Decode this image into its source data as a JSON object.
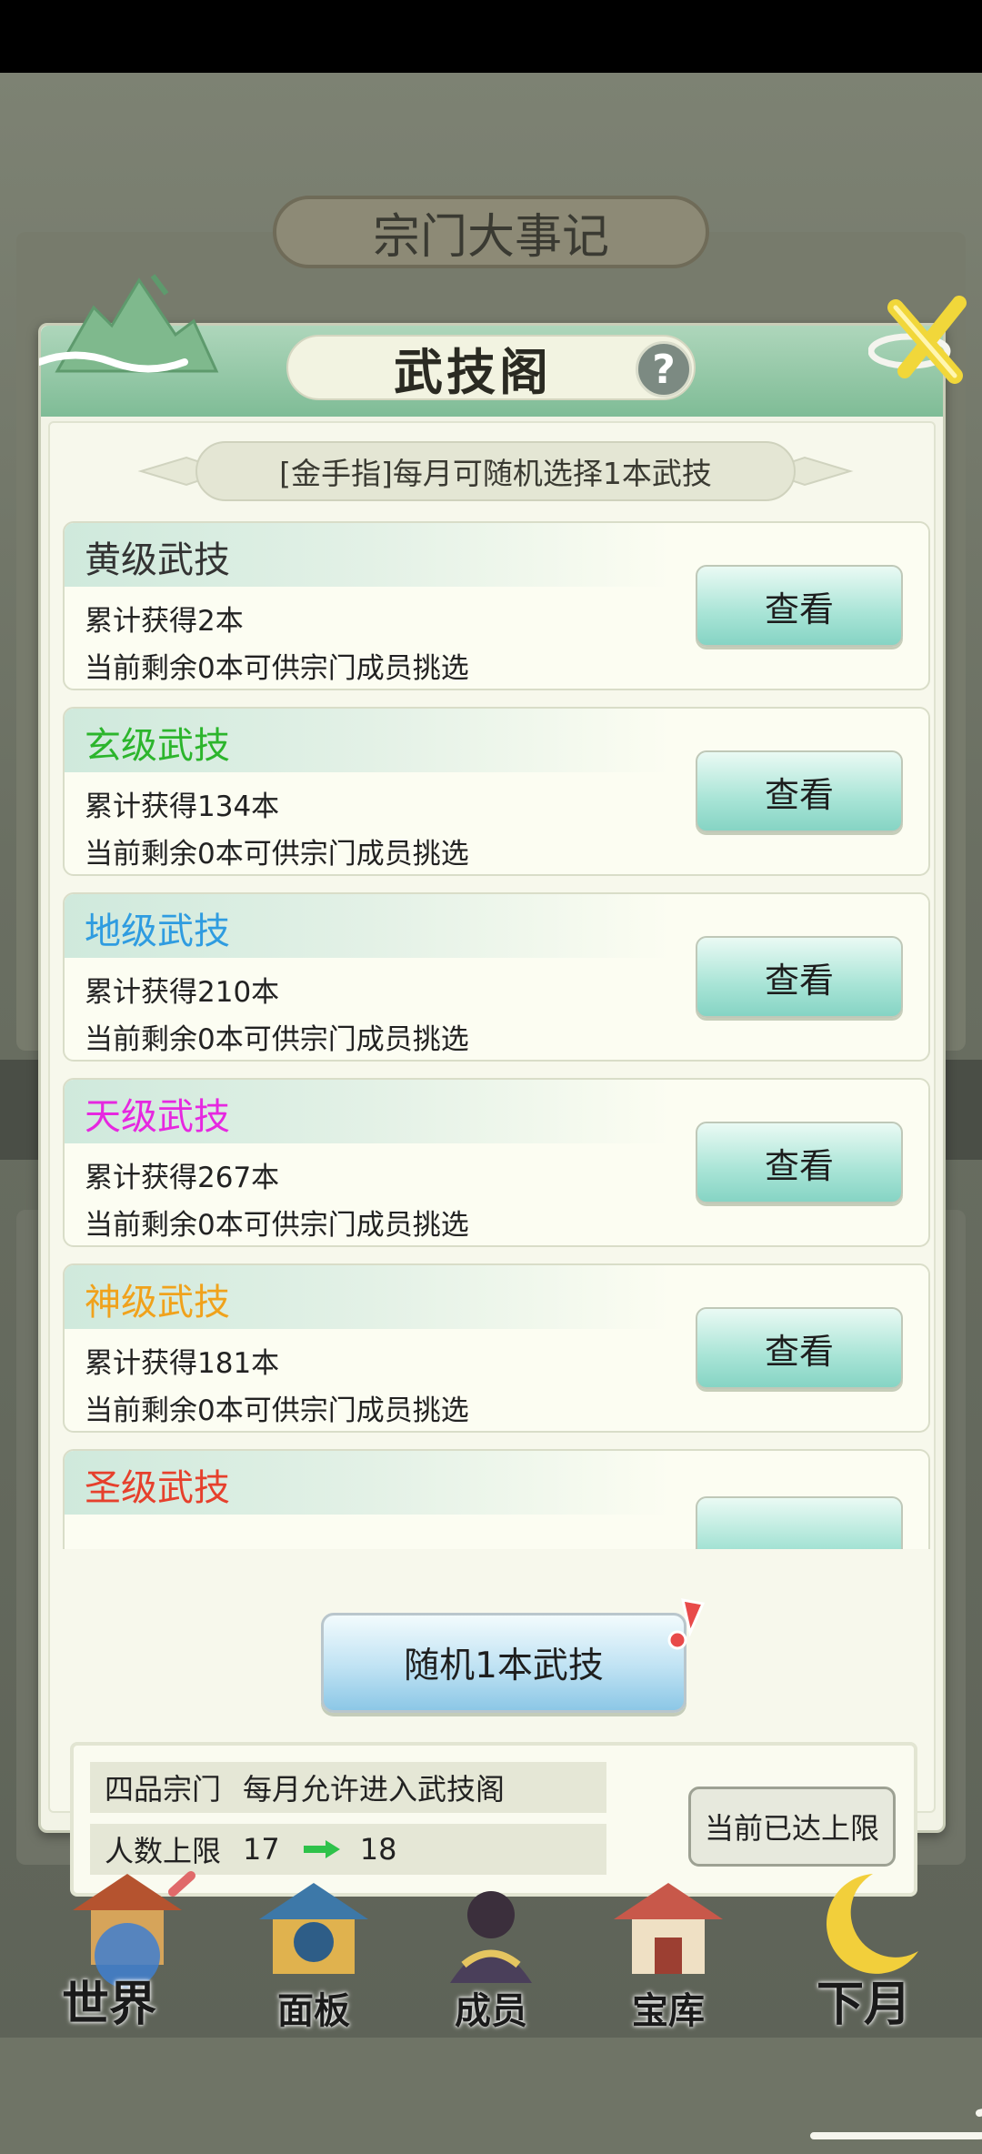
{
  "background": {
    "title": "宗门大事记"
  },
  "dialog": {
    "title": "武技阁",
    "help_icon": "?",
    "notice": "[金手指]每月可随机选择1本武技",
    "tiers": [
      {
        "name": "黄级武技",
        "color": "#333333",
        "obtained": "累计获得2本",
        "remaining": "当前剩余0本可供宗门成员挑选",
        "button": "查看"
      },
      {
        "name": "玄级武技",
        "color": "#2cb52c",
        "obtained": "累计获得134本",
        "remaining": "当前剩余0本可供宗门成员挑选",
        "button": "查看"
      },
      {
        "name": "地级武技",
        "color": "#2f9ce0",
        "obtained": "累计获得210本",
        "remaining": "当前剩余0本可供宗门成员挑选",
        "button": "查看"
      },
      {
        "name": "天级武技",
        "color": "#e628e0",
        "obtained": "累计获得267本",
        "remaining": "当前剩余0本可供宗门成员挑选",
        "button": "查看"
      },
      {
        "name": "神级武技",
        "color": "#f0a21c",
        "obtained": "累计获得181本",
        "remaining": "当前剩余0本可供宗门成员挑选",
        "button": "查看"
      },
      {
        "name": "圣级武技",
        "color": "#e6402c",
        "obtained": "",
        "remaining": "",
        "button": ""
      }
    ],
    "random_button": "随机1本武技",
    "info": {
      "sect_rank": "四品宗门",
      "entry_rule": "每月允许进入武技阁",
      "limit_label": "人数上限",
      "limit_from": "17",
      "limit_to": "18",
      "limit_button": "当前已达上限"
    }
  },
  "nav": [
    {
      "label": "世界",
      "icon": "pagoda-icon"
    },
    {
      "label": "面板",
      "icon": "gate-icon"
    },
    {
      "label": "成员",
      "icon": "member-icon"
    },
    {
      "label": "宝库",
      "icon": "treasury-icon"
    },
    {
      "label": "下月",
      "icon": "moon-icon"
    }
  ]
}
